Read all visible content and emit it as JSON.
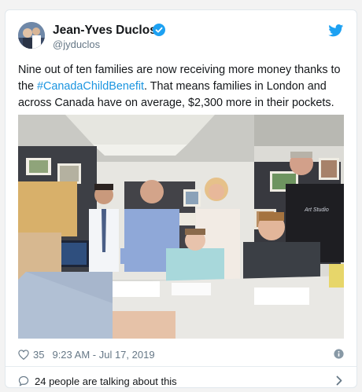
{
  "tweet": {
    "author_name": "Jean-Yves Duclos",
    "handle": "@jyduclos",
    "text_before": "Nine out of ten families are now receiving more money thanks to the ",
    "hashtag": "#CanadaChildBenefit",
    "text_after": ".  That means families in London and across Canada have on average, $2,300 more in their pockets.",
    "likes": "35",
    "timestamp": "9:23 AM - Jul 17, 2019",
    "talking_text": "24 people are talking about this",
    "poster_text": "Art Studio"
  },
  "colors": {
    "link": "#1b95e0",
    "twitter_blue": "#1da1f2",
    "muted": "#657786"
  },
  "icons": {
    "verified": "verified-badge-icon",
    "bird": "twitter-bird-icon",
    "like": "heart-icon",
    "info": "info-icon",
    "reply": "speech-bubble-icon",
    "chevron": "chevron-right-icon"
  }
}
